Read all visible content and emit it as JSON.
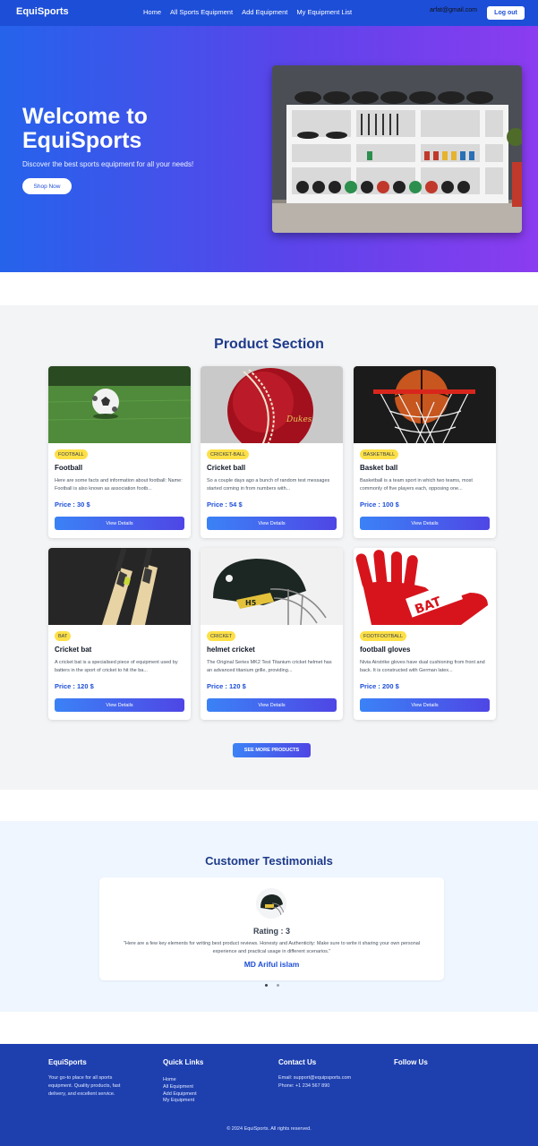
{
  "navbar": {
    "brand": "EquiSports",
    "links": [
      "Home",
      "All Sports Equipment",
      "Add Equipment",
      "My Equipment List"
    ],
    "user_email": "arfat@gmail.com",
    "logout_label": "Log out"
  },
  "hero": {
    "title": "Welcome to EquiSports",
    "subtitle": "Discover the best sports equipment for all your needs!",
    "cta_label": "Shop Now"
  },
  "products": {
    "title": "Product Section",
    "price_prefix": "Price : ",
    "button_label": "View Details",
    "see_more_label": "SEE MORE PRODUCTS",
    "items": [
      {
        "category": "FOOTBALL",
        "name": "Football",
        "description": "Here are some facts and information about football: Name: Football is also known as association footb...",
        "price": "30 $"
      },
      {
        "category": "CRICKET-BALL",
        "name": "Cricket ball",
        "description": "So a couple days ago a bunch of random test messages started coming in from numbers with...",
        "price": "54 $"
      },
      {
        "category": "BASKETBALL",
        "name": "Basket ball",
        "description": "Basketball is a team sport in which two teams, most commonly of five players each, opposing one...",
        "price": "100 $"
      },
      {
        "category": "BAT",
        "name": "Cricket bat",
        "description": "A cricket bat is a specialised piece of equipment used by batters in the sport of cricket to hit the ba...",
        "price": "120 $"
      },
      {
        "category": "CRICKET",
        "name": "helmet cricket",
        "description": "The Original Series MK2 Test Titanium cricket helmet has an advanced titanium grille, providing...",
        "price": "120 $"
      },
      {
        "category": "FOOTFOOTBALL",
        "name": "football gloves",
        "description": "Nivia Airstrike gloves have dual cushioning from front and back. It is constructed with German latex...",
        "price": "200 $"
      }
    ]
  },
  "testimonials": {
    "title": "Customer Testimonials",
    "rating_label": "Rating : 3",
    "quote": "\"Here are a few key elements for writing best product reviews. Honesty and Authenticity: Make sure to write it sharing your own personal experience and practical usage in different scenarios.\"",
    "author": "MD Ariful islam"
  },
  "footer": {
    "brand": "EquiSports",
    "about": "Your go-to place for all sports equipment. Quality products, fast delivery, and excellent service.",
    "quick_links_title": "Quick Links",
    "quick_links": [
      "Home",
      "All Equipment",
      "Add Equipment",
      "My Equipment"
    ],
    "contact_title": "Contact Us",
    "email": "Email: support@equipsports.com",
    "phone": "Phone: +1 234 567 890",
    "follow_title": "Follow Us",
    "copyright": "© 2024 EquiSports. All rights reserved."
  },
  "colors": {
    "nav_bg": "#1d4ed8",
    "accent": "#1e3a8a",
    "badge": "#fde047",
    "footer_bg": "#1e40af"
  }
}
